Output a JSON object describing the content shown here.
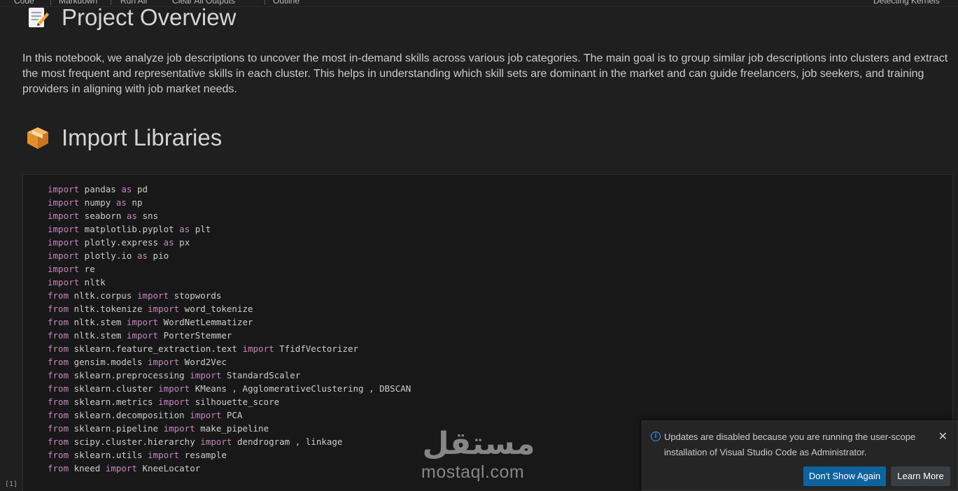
{
  "toolbar": {
    "items": [
      "Code",
      "Markdown",
      "Run All",
      "Clear All Outputs",
      "Outline"
    ],
    "kernel_status": "Detecting Kernels"
  },
  "notebook": {
    "project_overview": {
      "icon": "memo-icon",
      "title": "Project Overview",
      "paragraph": "In this notebook, we analyze job descriptions to uncover the most in-demand skills across various job categories. The main goal is to group similar job descriptions into clusters and extract the most frequent and representative skills in each cluster. This helps in understanding which skill sets are dominant in the market and can guide freelancers, job seekers, and training providers in aligning with job market needs."
    },
    "import_libraries": {
      "icon": "package-icon",
      "title": "Import Libraries"
    },
    "code_cell": {
      "execution_count": "[1]",
      "lines": [
        [
          "import",
          " pandas ",
          "as",
          " pd"
        ],
        [
          "import",
          " numpy ",
          "as",
          " np"
        ],
        [
          "import",
          " seaborn ",
          "as",
          " sns"
        ],
        [
          "import",
          " matplotlib.pyplot ",
          "as",
          " plt"
        ],
        [
          "import",
          " plotly.express ",
          "as",
          " px"
        ],
        [
          "import",
          " plotly.io ",
          "as",
          " pio"
        ],
        [
          "import",
          " re"
        ],
        [
          "import",
          " nltk"
        ],
        [
          "from",
          " nltk.corpus ",
          "import",
          " stopwords"
        ],
        [
          "from",
          " nltk.tokenize ",
          "import",
          " word_tokenize"
        ],
        [
          "from",
          " nltk.stem ",
          "import",
          " WordNetLemmatizer"
        ],
        [
          "from",
          " nltk.stem ",
          "import",
          " PorterStemmer"
        ],
        [
          "from",
          " sklearn.feature_extraction.text ",
          "import",
          " TfidfVectorizer"
        ],
        [
          "from",
          " gensim.models ",
          "import",
          " Word2Vec"
        ],
        [
          "from",
          " sklearn.preprocessing ",
          "import",
          " StandardScaler"
        ],
        [
          "from",
          " sklearn.cluster ",
          "import",
          " KMeans , AgglomerativeClustering , DBSCAN"
        ],
        [
          "from",
          " sklearn.metrics ",
          "import",
          " silhouette_score"
        ],
        [
          "from",
          " sklearn.decomposition ",
          "import",
          " PCA"
        ],
        [
          "from",
          " sklearn.pipeline ",
          "import",
          " make_pipeline"
        ],
        [
          "from",
          " scipy.cluster.hierarchy ",
          "import",
          " dendrogram , linkage"
        ],
        [
          "from",
          " sklearn.utils ",
          "import",
          " resample"
        ],
        [
          "from",
          " kneed ",
          "import",
          " KneeLocator"
        ]
      ]
    }
  },
  "watermark": {
    "arabic": "مستقل",
    "latin": "mostaql.com"
  },
  "notification": {
    "icon": "info-icon",
    "message": "Updates are disabled because you are running the user-scope installation of Visual Studio Code as Administrator.",
    "primary_button": "Don't Show Again",
    "secondary_button": "Learn More",
    "close_icon": "close-icon"
  },
  "colors": {
    "keyword": "#c586c0",
    "primary_button": "#0e639c",
    "info": "#3794ff"
  }
}
